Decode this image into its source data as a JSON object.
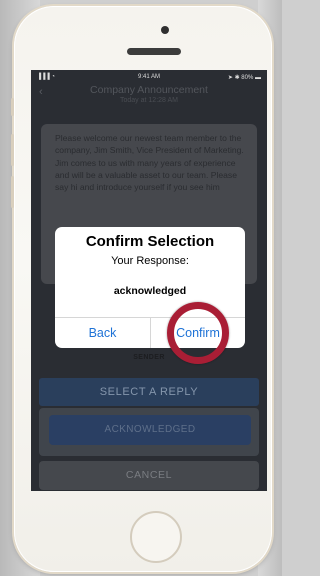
{
  "status_bar": {
    "signal": "▐▐▐ ◔",
    "time": "9:41 AM",
    "right": "➤ ✱ 80% ▬"
  },
  "nav": {
    "back": "‹",
    "title": "Company Announcement",
    "subtitle": "Today at 12:28 AM"
  },
  "message": {
    "text": "Please welcome our newest team member to the company, Jim Smith, Vice President of Marketing. Jim comes to us with many years of experience and will be a valuable asset to our team. Please say hi and introduce yourself if you see him"
  },
  "sender_label": "SENDER",
  "actions": {
    "select_reply": "SELECT A REPLY",
    "acknowledged": "ACKNOWLEDGED",
    "cancel": "CANCEL"
  },
  "dialog": {
    "title": "Confirm Selection",
    "subtitle": "Your Response:",
    "value": "acknowledged",
    "back": "Back",
    "confirm": "Confirm"
  },
  "colors": {
    "dialog_link": "#1e72d6",
    "highlight": "#a91e35",
    "button_blue": "#2a3f63"
  }
}
